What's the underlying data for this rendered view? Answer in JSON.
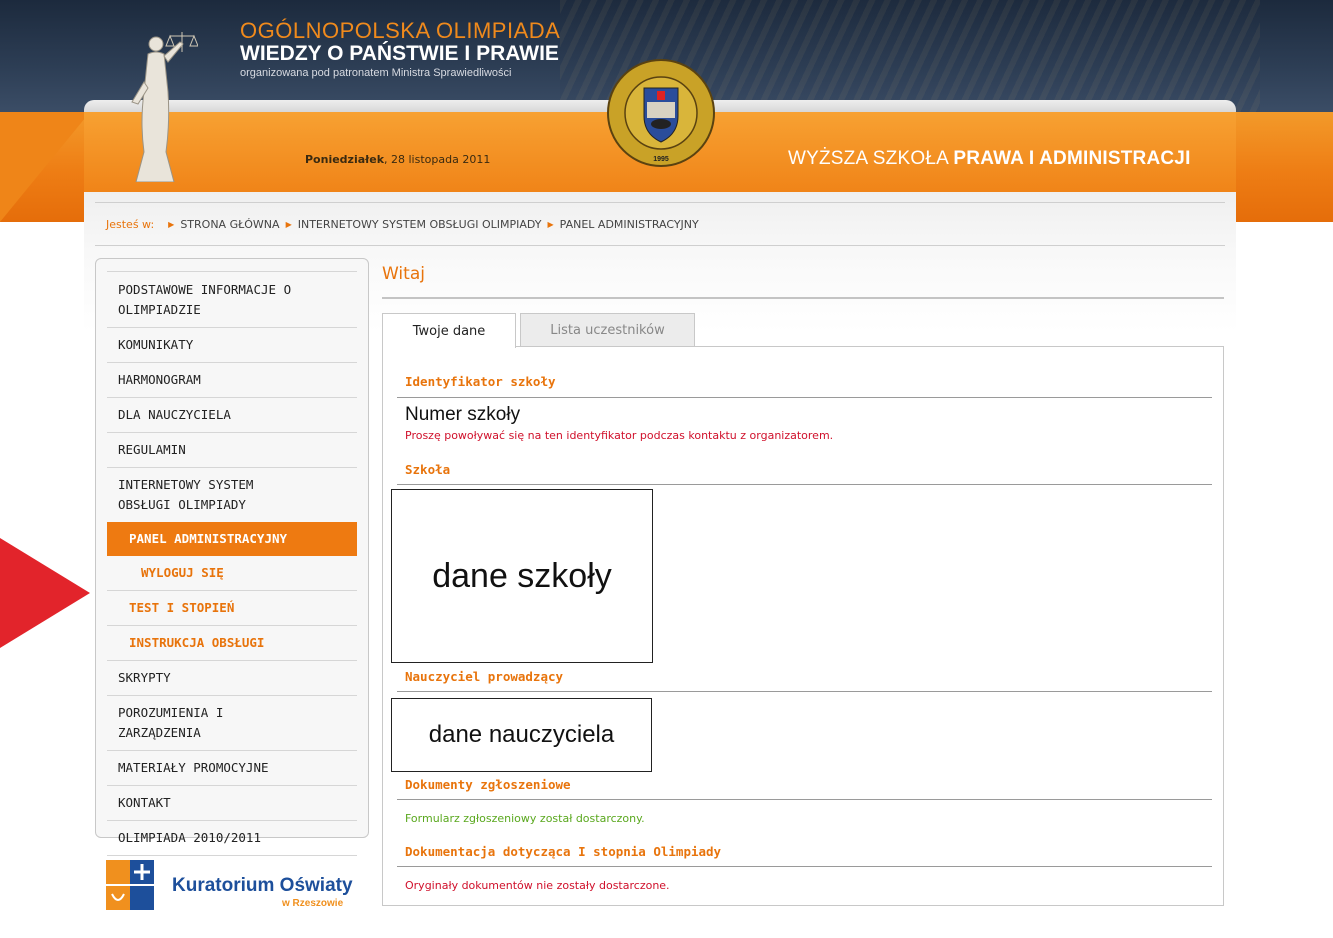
{
  "header": {
    "title_line1": "OGÓLNOPOLSKA OLIMPIADA",
    "title_line2": "WIEDZY O PAŃSTWIE I PRAWIE",
    "title_line3": "organizowana pod patronatem Ministra Sprawiedliwości",
    "date_day": "Poniedziałek",
    "date_rest": ", 28 listopada 2011",
    "school_part1": "WYŻSZA SZKOŁA ",
    "school_part2": "PRAWA I ADMINISTRACJI",
    "seal_text_top": "SZKOŁA PRAWA I ADMINISTRACJI",
    "seal_text_left": "WYŻSZA",
    "seal_year": "1995"
  },
  "breadcrumb": {
    "label": "Jesteś w:",
    "items": [
      "STRONA GŁÓWNA",
      "INTERNETOWY SYSTEM OBSŁUGI OLIMPIADY",
      "PANEL ADMINISTRACYJNY"
    ]
  },
  "sidebar": {
    "items": [
      {
        "label": "PODSTAWOWE INFORMACJE O OLIMPIADZIE"
      },
      {
        "label": "KOMUNIKATY"
      },
      {
        "label": "HARMONOGRAM"
      },
      {
        "label": "DLA NAUCZYCIELA"
      },
      {
        "label": "REGULAMIN"
      },
      {
        "label": "INTERNETOWY SYSTEM OBSŁUGI OLIMPIADY"
      },
      {
        "label": "PANEL ADMINISTRACYJNY"
      },
      {
        "label": "WYLOGUJ SIĘ"
      },
      {
        "label": "TEST I STOPIEŃ"
      },
      {
        "label": "INSTRUKCJA OBSŁUGI"
      },
      {
        "label": "SKRYPTY"
      },
      {
        "label": "POROZUMIENIA I ZARZĄDZENIA"
      },
      {
        "label": "MATERIAŁY PROMOCYJNE"
      },
      {
        "label": "KONTAKT"
      },
      {
        "label": "OLIMPIADA 2010/2011"
      }
    ],
    "partner_name": "Kuratorium Oświaty",
    "partner_city": "w Rzeszowie"
  },
  "main": {
    "heading": "Witaj",
    "tabs": [
      {
        "label": "Twoje dane",
        "active": true
      },
      {
        "label": "Lista uczestników",
        "active": false
      }
    ],
    "sections": {
      "school_id_title": "Identyfikator szkoły",
      "school_number": "Numer szkoły",
      "school_id_note": "Proszę powoływać się na ten identyfikator podczas kontaktu z organizatorem.",
      "school_title": "Szkoła",
      "school_placeholder": "dane szkoły",
      "teacher_title": "Nauczyciel prowadzący",
      "teacher_placeholder": "dane nauczyciela",
      "documents_title": "Dokumenty zgłoszeniowe",
      "documents_note": "Formularz zgłoszeniowy został dostarczony.",
      "stage1_title": "Dokumentacja dotycząca I stopnia Olimpiady",
      "stage1_note": "Oryginały dokumentów nie zostały dostarczone."
    }
  },
  "colors": {
    "accent": "#e8740c",
    "header_dark": "#2d3e55",
    "error": "#d0102b",
    "success": "#5aa81e",
    "annotation_arrow": "#e2242b"
  }
}
